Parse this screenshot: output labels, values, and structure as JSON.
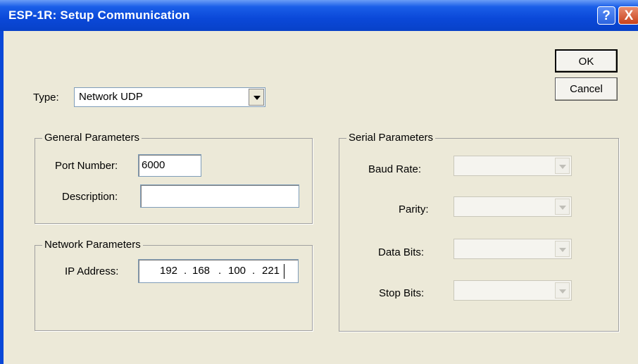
{
  "window": {
    "title": "ESP-1R: Setup Communication",
    "help_glyph": "?",
    "close_glyph": "X",
    "title_color": "#0a48d8"
  },
  "buttons": {
    "ok_label": "OK",
    "cancel_label": "Cancel"
  },
  "type": {
    "label": "Type:",
    "value": "Network UDP"
  },
  "general_parameters": {
    "title": "General Parameters",
    "port_label": "Port Number:",
    "port_value": "6000",
    "description_label": "Description:",
    "description_value": ""
  },
  "network_parameters": {
    "title": "Network Parameters",
    "ip_label": "IP Address:",
    "ip_octets": [
      "192",
      "168",
      "100",
      "221"
    ],
    "dot": "."
  },
  "serial_parameters": {
    "title": "Serial Parameters",
    "baud_label": "Baud Rate:",
    "parity_label": "Parity:",
    "data_bits_label": "Data Bits:",
    "stop_bits_label": "Stop Bits:"
  }
}
